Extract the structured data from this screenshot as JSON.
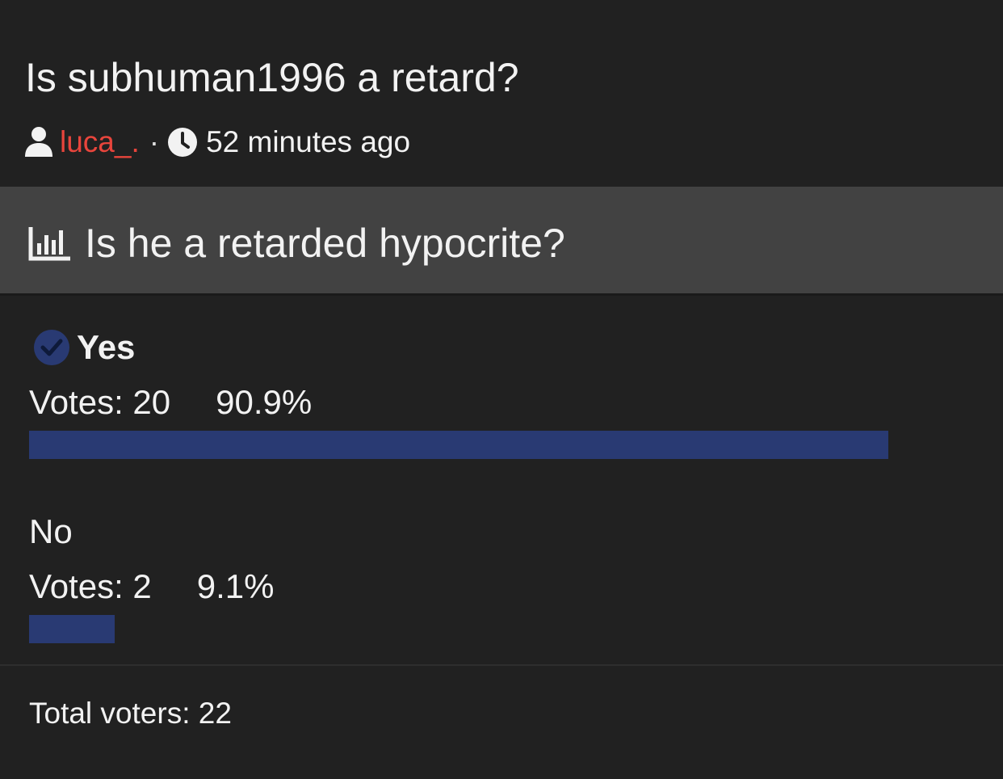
{
  "thread": {
    "title": "Is subhuman1996 a retard?",
    "author": "luca_.",
    "separator": "·",
    "time_ago": "52 minutes ago",
    "author_icon": "user-icon",
    "time_icon": "clock-icon"
  },
  "poll": {
    "question": "Is he a retarded hypocrite?",
    "question_icon": "poll-chart-icon",
    "options": [
      {
        "label": "Yes",
        "voted_by_user": true,
        "votes_text": "Votes: 20",
        "percent_text": "90.9%",
        "percent": 90.9
      },
      {
        "label": "No",
        "voted_by_user": false,
        "votes_text": "Votes: 2",
        "percent_text": "9.1%",
        "percent": 9.1
      }
    ],
    "total_text": "Total voters: 22"
  },
  "colors": {
    "background": "#212121",
    "question_bar": "#424242",
    "author_link": "#e8453c",
    "bar_fill": "#293a73",
    "check_badge": "#293a73"
  }
}
